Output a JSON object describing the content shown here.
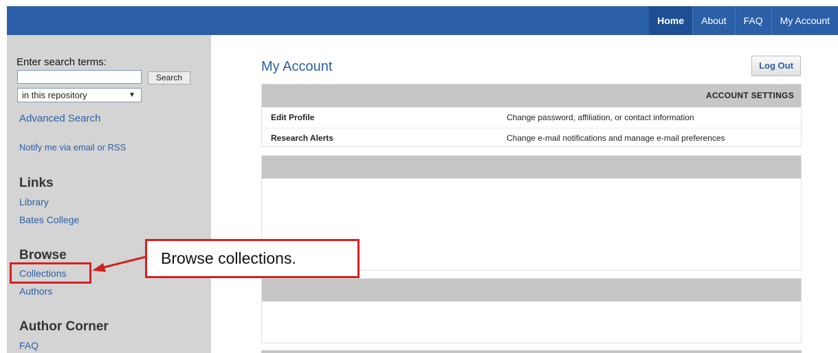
{
  "topnav": {
    "items": [
      {
        "label": "Home",
        "active": true
      },
      {
        "label": "About"
      },
      {
        "label": "FAQ"
      },
      {
        "label": "My Account"
      }
    ]
  },
  "sidebar": {
    "search_label": "Enter search terms:",
    "search_value": "",
    "search_button": "Search",
    "scope_selected": "in this repository",
    "advanced_search": "Advanced Search",
    "notify": "Notify me via email or RSS",
    "links_heading": "Links",
    "links": [
      "Library",
      "Bates College"
    ],
    "browse_heading": "Browse",
    "browse": [
      "Collections",
      "Authors"
    ],
    "author_heading": "Author Corner",
    "author_links": [
      "FAQ"
    ]
  },
  "main": {
    "title": "My Account",
    "logout": "Log Out",
    "settings_heading": "ACCOUNT SETTINGS",
    "settings_rows": [
      {
        "name": "Edit Profile",
        "desc": "Change password, affiliation, or contact information"
      },
      {
        "name": "Research Alerts",
        "desc": "Change e-mail notifications and manage e-mail preferences"
      }
    ]
  },
  "annotation": {
    "callout_text": "Browse collections.",
    "color": "#d32020"
  },
  "colors": {
    "nav_bg": "#2b5fa7",
    "sidebar_bg": "#d4d4d4",
    "link": "#2b5fa7",
    "panel_head": "#c6c6c6"
  }
}
